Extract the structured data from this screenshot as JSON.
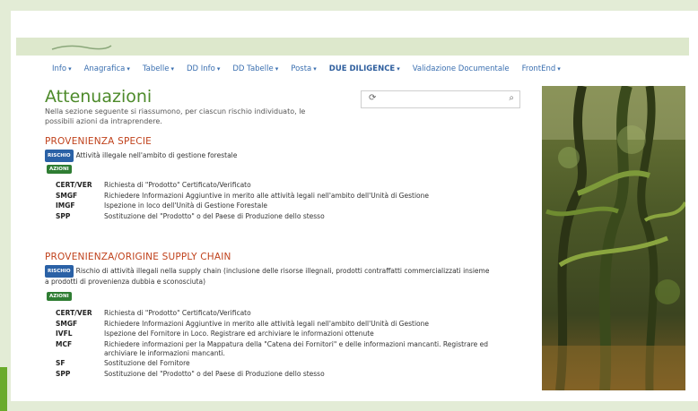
{
  "nav": [
    {
      "label": "Info",
      "caret": "▾",
      "bold": false
    },
    {
      "label": "Anagrafica",
      "caret": "▾",
      "bold": false
    },
    {
      "label": "Tabelle",
      "caret": "▾",
      "bold": false
    },
    {
      "label": "DD Info",
      "caret": "▾",
      "bold": false
    },
    {
      "label": "DD Tabelle",
      "caret": "▾",
      "bold": false
    },
    {
      "label": "Posta",
      "caret": "▾",
      "bold": false
    },
    {
      "label": "DUE DILIGENCE",
      "caret": "▾",
      "bold": true
    },
    {
      "label": "Validazione Documentale",
      "caret": "",
      "bold": false
    },
    {
      "label": "FrontEnd",
      "caret": "▾",
      "bold": false
    }
  ],
  "page": {
    "title": "Attenuazioni",
    "intro": "Nella sezione seguente si riassumono, per ciascun rischio individuato, le possibili azioni da intraprendere."
  },
  "search": {
    "placeholder": "",
    "refresh_icon": "refresh-icon",
    "search_icon": "search-icon"
  },
  "sections": [
    {
      "title": "PROVENIENZA SPECIE",
      "risk_badge": "RISCHIO",
      "risk_text": "Attività illegale nell'ambito di gestione forestale",
      "actions_badge": "AZIONI",
      "actions": [
        {
          "code": "CERT/VER",
          "desc": "Richiesta di \"Prodotto\" Certificato/Verificato"
        },
        {
          "code": "SMGF",
          "desc": "Richiedere Informazioni Aggiuntive in merito alle attività legali nell'ambito dell'Unità di Gestione"
        },
        {
          "code": "IMGF",
          "desc": "Ispezione in loco dell'Unità di Gestione Forestale"
        },
        {
          "code": "SPP",
          "desc": "Sostituzione del \"Prodotto\" o del Paese di Produzione dello stesso"
        }
      ]
    },
    {
      "title": "PROVENIENZA/ORIGINE SUPPLY CHAIN",
      "risk_badge": "RISCHIO",
      "risk_text": "Rischio di attività illegali nella supply chain (inclusione delle risorse illegnali, prodotti contraffatti commercializzati insieme a prodotti di provenienza dubbia e sconosciuta)",
      "actions_badge": "AZIONI",
      "actions": [
        {
          "code": "CERT/VER",
          "desc": "Richiesta di \"Prodotto\" Certificato/Verificato"
        },
        {
          "code": "SMGF",
          "desc": "Richiedere Informazioni Aggiuntive in merito alle attività legali nell'ambito dell'Unità di Gestione"
        },
        {
          "code": "IVFL",
          "desc": "Ispezione del Fornitore in Loco. Registrare ed archiviare le informazioni ottenute"
        },
        {
          "code": "MCF",
          "desc": "Richiedere informazioni per la Mappatura della \"Catena dei Fornitori\" e delle informazioni mancanti. Registrare ed archiviare le informazioni mancanti."
        },
        {
          "code": "SF",
          "desc": "Sostituzione del Fornitore"
        },
        {
          "code": "SPP",
          "desc": "Sostituzione del \"Prodotto\" o del Paese di Produzione dello stesso"
        }
      ]
    }
  ],
  "colors": {
    "title": "#4d8a2a",
    "section": "#c0421c",
    "link": "#3a6fb0",
    "risk": "#2a61a6",
    "azioni": "#2f7d33"
  }
}
